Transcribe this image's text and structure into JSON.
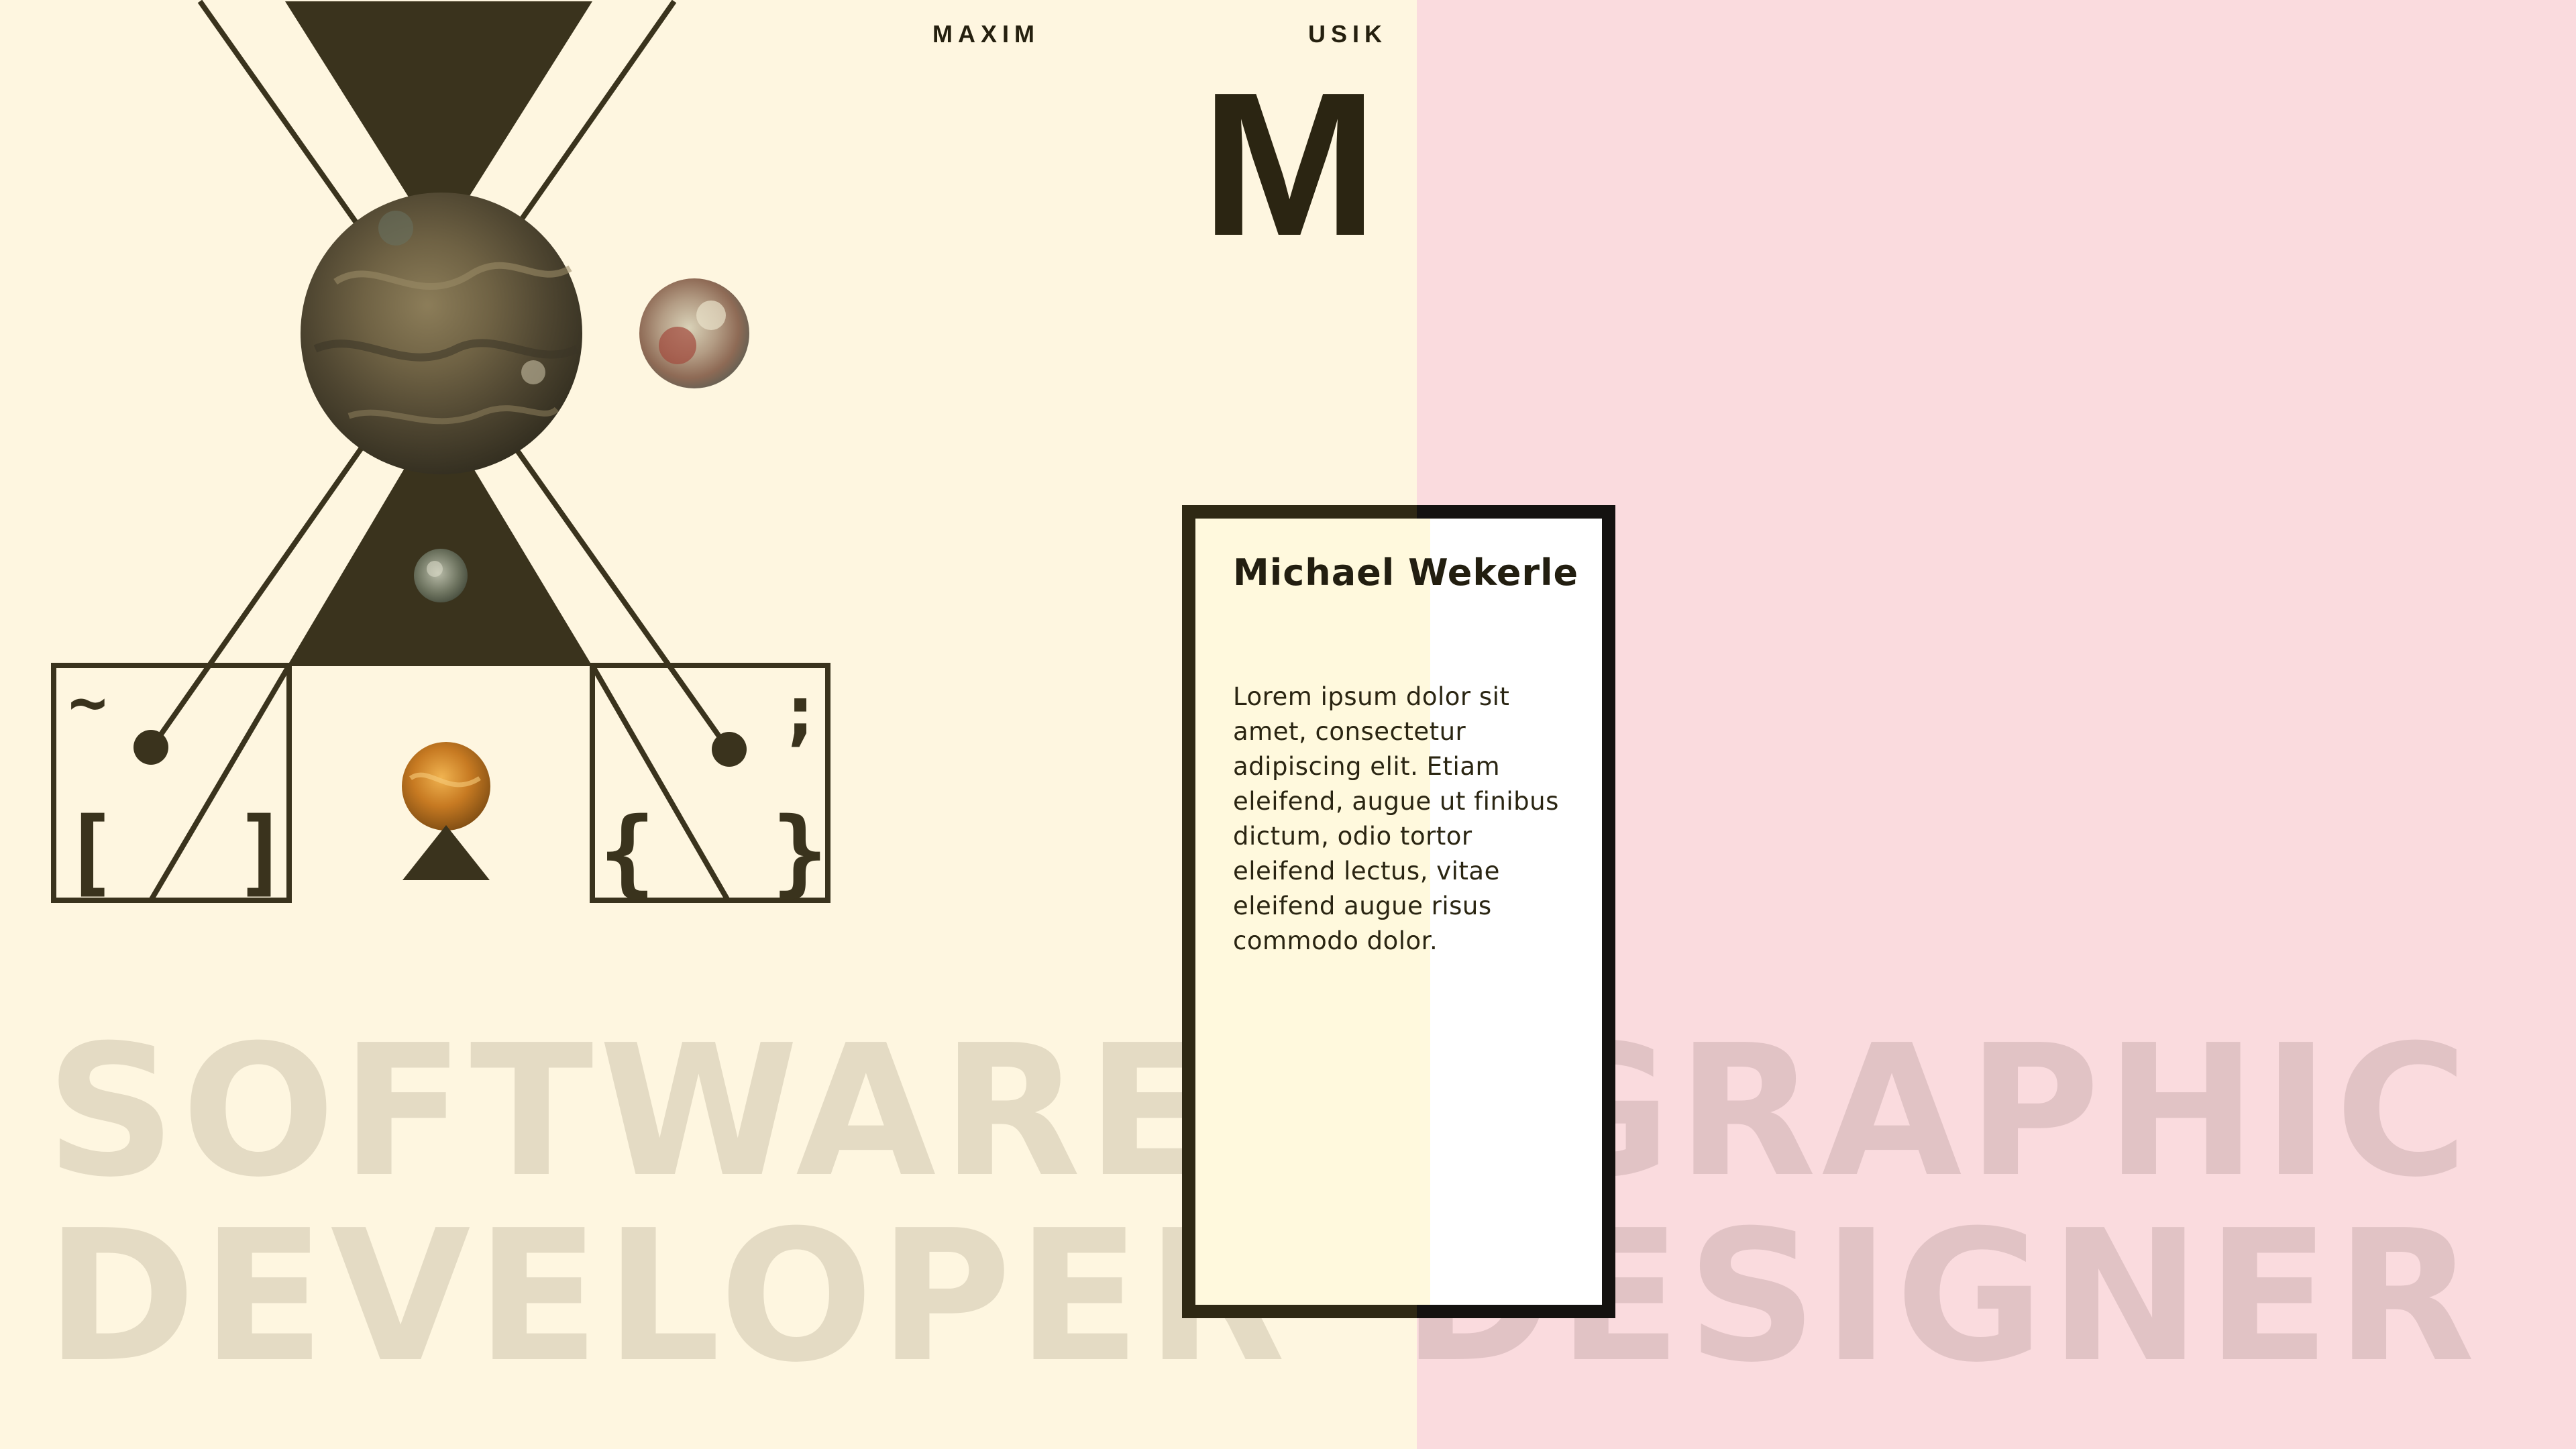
{
  "header": {
    "label_left": "MAXIM",
    "label_right": "USIK",
    "monogram": "M"
  },
  "background_words": {
    "left_line1": "SOFTWARE",
    "left_line2": "DEVELOPER",
    "right_line1": "GRAPHIC",
    "right_line2": "DESIGNER"
  },
  "card": {
    "name": "Michael Wekerle",
    "body": "Lorem ipsum dolor sit amet, consectetur adipiscing elit. Etiam eleifend, augue ut finibus dictum, odio tortor eleifend lectus, vitae eleifend augue risus commodo dolor."
  },
  "glyphs": {
    "tilde": "~",
    "semicolon": ";",
    "bracket_open": "[",
    "bracket_close": "]",
    "brace_open": "{",
    "brace_close": "}"
  },
  "colors": {
    "left_background": "#fef6e0",
    "right_background": "#fadbde",
    "ink": "#3a331d",
    "left_word": "#e4dbc4",
    "right_word": "#e1c3c5"
  },
  "icons": [
    "planet-large-icon",
    "planet-medium-icon",
    "planet-small-icon",
    "planet-orange-icon"
  ]
}
